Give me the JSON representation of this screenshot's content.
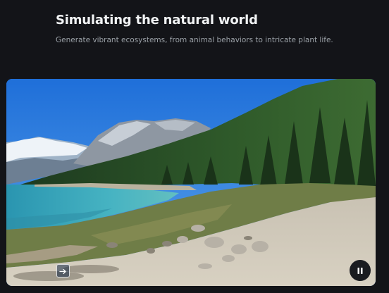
{
  "section": {
    "title": "Simulating the natural world",
    "subtitle": "Generate vibrant ecosystems, from animal behaviors to intricate plant life."
  },
  "video": {
    "state": "playing",
    "controls": {
      "next_icon": "arrow-right-icon",
      "pause_icon": "pause-icon"
    }
  },
  "colors": {
    "page_background": "#131418",
    "title_text": "#f1f3f4",
    "subtitle_text": "#9aa0a6"
  }
}
